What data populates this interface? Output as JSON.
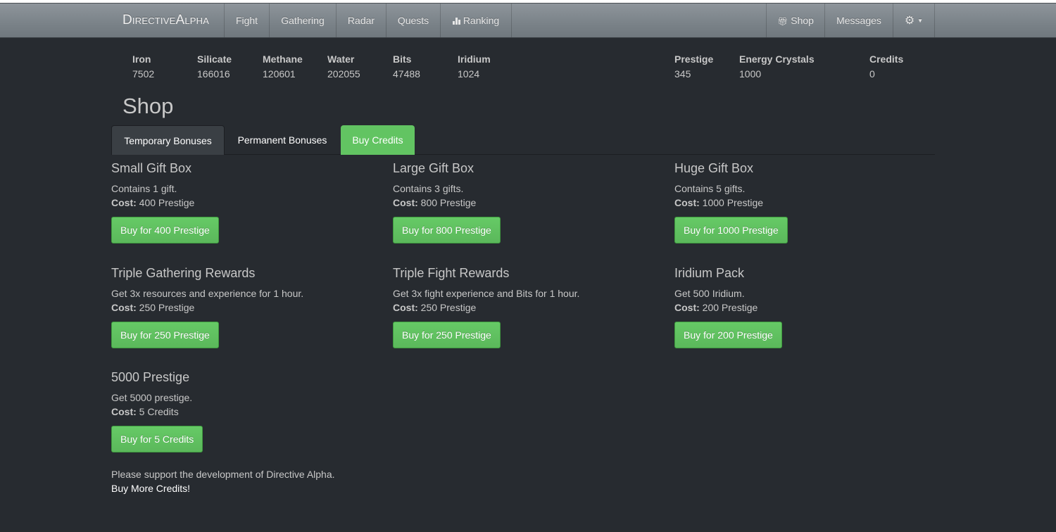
{
  "nav": {
    "brand": "DirectiveAlpha",
    "left_items": [
      "Fight",
      "Gathering",
      "Radar",
      "Quests",
      "Ranking"
    ],
    "right_items": [
      "Shop",
      "Messages"
    ],
    "settings_icon": "gear-icon"
  },
  "resources": [
    {
      "label": "Iron",
      "value": "7502"
    },
    {
      "label": "Silicate",
      "value": "166016"
    },
    {
      "label": "Methane",
      "value": "120601"
    },
    {
      "label": "Water",
      "value": "202055"
    },
    {
      "label": "Bits",
      "value": "47488"
    },
    {
      "label": "Iridium",
      "value": "1024"
    },
    {
      "label": "Prestige",
      "value": "345"
    },
    {
      "label": "Energy Crystals",
      "value": "1000"
    },
    {
      "label": "Credits",
      "value": "0"
    }
  ],
  "page": {
    "title": "Shop",
    "tabs": [
      "Temporary Bonuses",
      "Permanent Bonuses",
      "Buy Credits"
    ]
  },
  "cost_label": "Cost:",
  "items": [
    {
      "title": "Small Gift Box",
      "desc": "Contains 1 gift.",
      "cost": " 400 Prestige",
      "button": "Buy for 400 Prestige"
    },
    {
      "title": "Large Gift Box",
      "desc": "Contains 3 gifts.",
      "cost": " 800 Prestige",
      "button": "Buy for 800 Prestige"
    },
    {
      "title": "Huge Gift Box",
      "desc": "Contains 5 gifts.",
      "cost": " 1000 Prestige",
      "button": "Buy for 1000 Prestige"
    },
    {
      "title": "Triple Gathering Rewards",
      "desc": "Get 3x resources and experience for 1 hour.",
      "cost": " 250 Prestige",
      "button": "Buy for 250 Prestige"
    },
    {
      "title": "Triple Fight Rewards",
      "desc": "Get 3x fight experience and Bits for 1 hour.",
      "cost": " 250 Prestige",
      "button": "Buy for 250 Prestige"
    },
    {
      "title": "Iridium Pack",
      "desc": "Get 500 Iridium.",
      "cost": " 200 Prestige",
      "button": "Buy for 200 Prestige"
    },
    {
      "title": "5000 Prestige",
      "desc": "Get 5000 prestige.",
      "cost": " 5 Credits",
      "button": "Buy for 5 Credits"
    }
  ],
  "support": {
    "text": "Please support the development of Directive Alpha.",
    "link": "Buy More Credits!"
  },
  "colors": {
    "background": "#272b30",
    "navbar": "#7a8288",
    "success": "#62c462"
  }
}
